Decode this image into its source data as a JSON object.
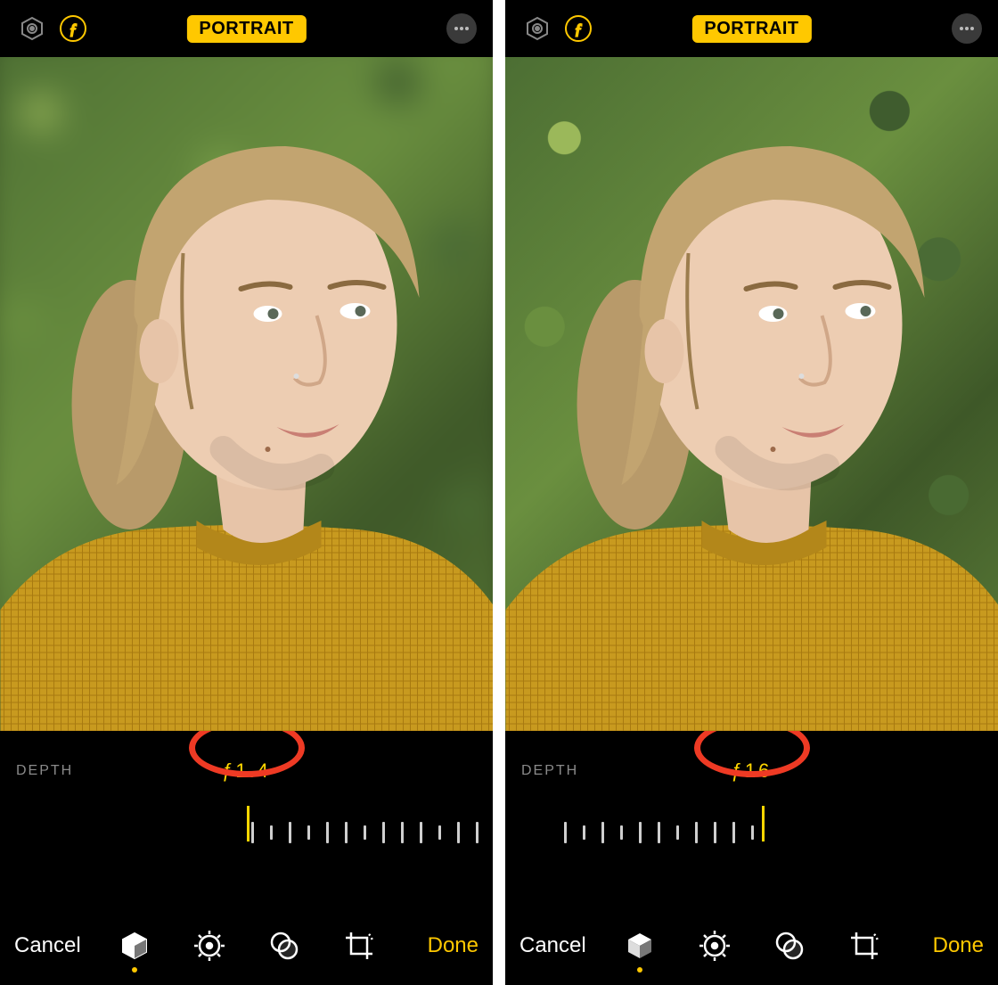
{
  "shared": {
    "mode_label": "PORTRAIT",
    "depth_label": "DEPTH",
    "cancel_label": "Cancel",
    "done_label": "Done",
    "accent_color": "#ffc800",
    "annotation_color": "#ee3a24",
    "tool_icons": [
      "lighting-cube",
      "adjust-dial",
      "filters-circles",
      "crop-rotate"
    ]
  },
  "panels": [
    {
      "id": "left",
      "f_value": "ƒ1.4",
      "background_blur": true,
      "slider_center_pct": 50,
      "ticks_start_pct": 50,
      "tick_count": 16,
      "active_tool_index": 0
    },
    {
      "id": "right",
      "f_value": "ƒ16",
      "background_blur": false,
      "slider_center_pct": 52,
      "ticks_start_pct": 12,
      "tick_count": 16,
      "active_tool_index": 0
    }
  ]
}
